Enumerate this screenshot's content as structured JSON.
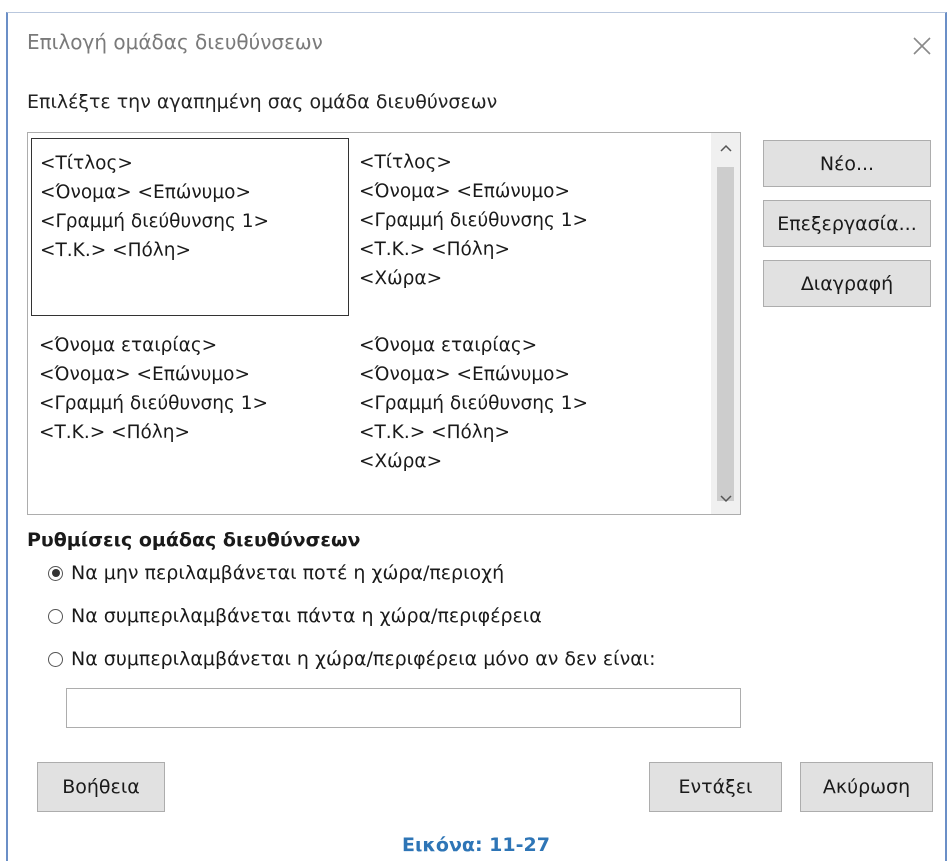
{
  "dialog": {
    "title": "Επιλογή ομάδας διευθύνσεων",
    "list_label": "Επιλέξτε την αγαπημένη σας ομάδα διευθύνσεων",
    "blocks": [
      {
        "lines": [
          "<Τίτλος>",
          "<Όνομα> <Επώνυμο>",
          "<Γραμμή διεύθυνσης 1>",
          "<Τ.Κ.> <Πόλη>"
        ],
        "selected": true
      },
      {
        "lines": [
          "<Τίτλος>",
          "<Όνομα> <Επώνυμο>",
          "<Γραμμή διεύθυνσης 1>",
          "<Τ.Κ.> <Πόλη>",
          "<Χώρα>"
        ],
        "selected": false
      },
      {
        "lines": [
          "<Όνομα εταιρίας>",
          "<Όνομα> <Επώνυμο>",
          "<Γραμμή διεύθυνσης 1>",
          "<Τ.Κ.> <Πόλη>"
        ],
        "selected": false
      },
      {
        "lines": [
          "<Όνομα εταιρίας>",
          "<Όνομα> <Επώνυμο>",
          "<Γραμμή διεύθυνσης 1>",
          "<Τ.Κ.> <Πόλη>",
          "<Χώρα>"
        ],
        "selected": false
      }
    ],
    "side_buttons": {
      "new": "Νέο...",
      "edit": "Επεξεργασία...",
      "delete": "Διαγραφή"
    },
    "settings": {
      "title": "Ρυθμίσεις ομάδας διευθύνσεων",
      "options": [
        {
          "label": "Να μην περιλαμβάνεται ποτέ η χώρα/περιοχή",
          "checked": true
        },
        {
          "label": "Να συμπεριλαμβάνεται πάντα η χώρα/περιφέρεια",
          "checked": false
        },
        {
          "label": "Να συμπεριλαμβάνεται η χώρα/περιφέρεια μόνο αν δεν είναι:",
          "checked": false
        }
      ],
      "country_value": ""
    },
    "footer_buttons": {
      "help": "Βοήθεια",
      "ok": "Εντάξει",
      "cancel": "Ακύρωση"
    }
  },
  "caption": "Εικόνα: 11-27"
}
